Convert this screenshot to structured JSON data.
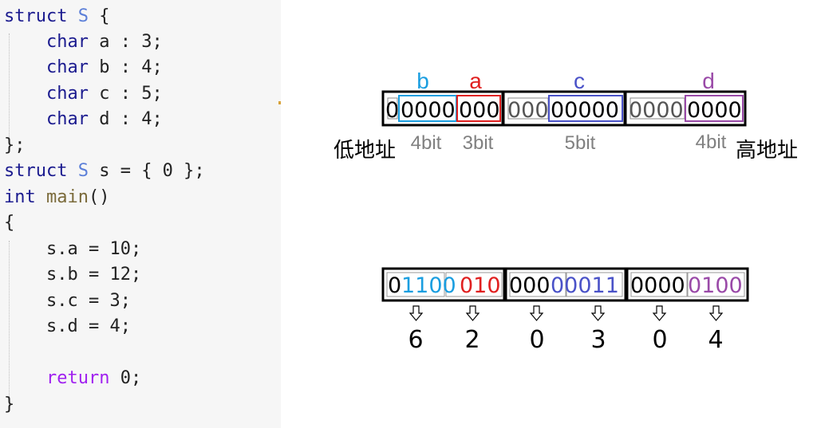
{
  "code": {
    "lines": [
      {
        "id": "line1",
        "tokens": [
          {
            "cls": "kw",
            "text": "struct "
          },
          {
            "cls": "ty",
            "text": "S"
          },
          {
            "cls": "",
            "text": " {"
          }
        ]
      },
      {
        "id": "line2",
        "tokens": [
          {
            "cls": "",
            "text": "    "
          },
          {
            "cls": "kw",
            "text": "char"
          },
          {
            "cls": "",
            "text": " a : 3;"
          }
        ]
      },
      {
        "id": "line3",
        "tokens": [
          {
            "cls": "",
            "text": "    "
          },
          {
            "cls": "kw",
            "text": "char"
          },
          {
            "cls": "",
            "text": " b : 4;"
          }
        ]
      },
      {
        "id": "line4",
        "tokens": [
          {
            "cls": "",
            "text": "    "
          },
          {
            "cls": "kw",
            "text": "char"
          },
          {
            "cls": "",
            "text": " c : 5;"
          }
        ]
      },
      {
        "id": "line5",
        "tokens": [
          {
            "cls": "",
            "text": "    "
          },
          {
            "cls": "kw",
            "text": "char"
          },
          {
            "cls": "",
            "text": " d : 4;"
          }
        ]
      },
      {
        "id": "line6",
        "tokens": [
          {
            "cls": "",
            "text": "};"
          }
        ]
      },
      {
        "id": "line7",
        "tokens": [
          {
            "cls": "kw",
            "text": "struct "
          },
          {
            "cls": "ty",
            "text": "S"
          },
          {
            "cls": "",
            "text": " s = { 0 };"
          }
        ]
      },
      {
        "id": "line8",
        "tokens": [
          {
            "cls": "kw",
            "text": "int "
          },
          {
            "cls": "fn",
            "text": "main"
          },
          {
            "cls": "",
            "text": "()"
          }
        ]
      },
      {
        "id": "line9",
        "tokens": [
          {
            "cls": "",
            "text": "{"
          }
        ]
      },
      {
        "id": "line10",
        "tokens": [
          {
            "cls": "",
            "text": "    s.a = 10;"
          }
        ]
      },
      {
        "id": "line11",
        "tokens": [
          {
            "cls": "",
            "text": "    s.b = 12;"
          }
        ]
      },
      {
        "id": "line12",
        "tokens": [
          {
            "cls": "",
            "text": "    s.c = 3;"
          }
        ]
      },
      {
        "id": "line13",
        "tokens": [
          {
            "cls": "",
            "text": "    s.d = 4;"
          }
        ]
      },
      {
        "id": "line14",
        "tokens": [
          {
            "cls": "",
            "text": ""
          }
        ]
      },
      {
        "id": "line15",
        "tokens": [
          {
            "cls": "",
            "text": "    "
          },
          {
            "cls": "rt",
            "text": "return"
          },
          {
            "cls": "",
            "text": " 0;"
          }
        ]
      },
      {
        "id": "line16",
        "tokens": [
          {
            "cls": "",
            "text": "}"
          }
        ]
      }
    ]
  },
  "colors": {
    "b": "#1a9ee0",
    "a": "#e02020",
    "c": "#4a52c8",
    "d": "#9a4aa8",
    "gray": "#808080",
    "black": "#000000"
  },
  "top_diagram": {
    "field_labels": {
      "b": "b",
      "a": "a",
      "c": "c",
      "d": "d"
    },
    "byte1": {
      "lead": "0",
      "b_bits": "0000",
      "a_bits": "000"
    },
    "byte2": {
      "lead": "000",
      "c_bits": "00000"
    },
    "byte3": {
      "lead": "0000",
      "d_bits": "0000"
    },
    "bit_labels": {
      "b": "4bit",
      "a": "3bit",
      "c": "5bit",
      "d": "4bit"
    },
    "low_addr": "低地址",
    "high_addr": "高地址"
  },
  "bottom_diagram": {
    "byte1": {
      "lead": "0",
      "b_bits": "1100",
      "a_bits": "010"
    },
    "byte2": {
      "lead": "000",
      "c_bits": "00011"
    },
    "byte3": {
      "lead": "0000",
      "d_bits": "0100"
    },
    "hex_values": [
      "6",
      "2",
      "0",
      "3",
      "0",
      "4"
    ]
  }
}
